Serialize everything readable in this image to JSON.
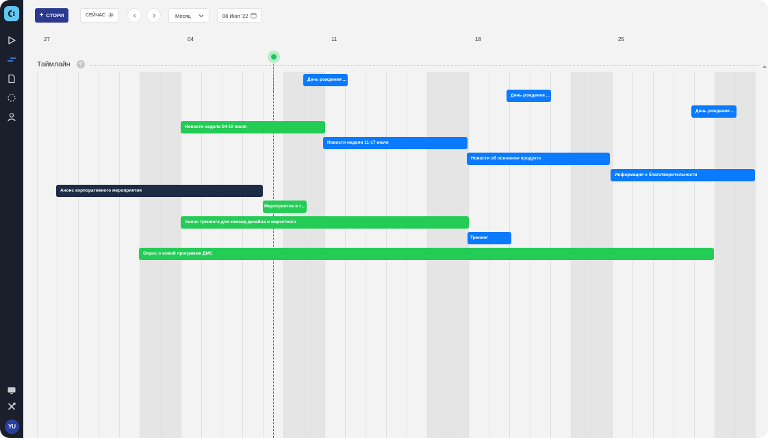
{
  "toolbar": {
    "add_story_label": "СТОРИ",
    "now_label": "СЕЙЧАС",
    "period_value": "Месяц",
    "date_value": "08 Июл '22"
  },
  "weeks": [
    "27",
    "04",
    "11",
    "18",
    "25"
  ],
  "timeline": {
    "title": "Таймлайн"
  },
  "user": {
    "initials": "YU"
  },
  "colors": {
    "sidebar": "#1a1f2b",
    "primary_button": "#2b3a8f",
    "event_blue": "#0a7aff",
    "event_green": "#22cc55",
    "event_navy": "#1d2b45",
    "today_marker": "#22c55e"
  },
  "events": [
    {
      "label": "День рождения ...",
      "color": "blue"
    },
    {
      "label": "День рождения ...",
      "color": "blue"
    },
    {
      "label": "День рождения ...",
      "color": "blue"
    },
    {
      "label": "Новости недели 04-10 июля",
      "color": "green"
    },
    {
      "label": "Новости недели 11-17 июля",
      "color": "blue"
    },
    {
      "label": "Новости об основном продукте",
      "color": "blue"
    },
    {
      "label": "Информация о благотворительности",
      "color": "blue"
    },
    {
      "label": "Анонс корпоративного мероприятия",
      "color": "navy"
    },
    {
      "label": "Мероприятие в с...",
      "color": "green"
    },
    {
      "label": "Анонс тренинга для команд дизайна и маркетинга",
      "color": "green"
    },
    {
      "label": "Тренинг",
      "color": "blue"
    },
    {
      "label": "Опрос о новой программе ДМС",
      "color": "green"
    }
  ]
}
